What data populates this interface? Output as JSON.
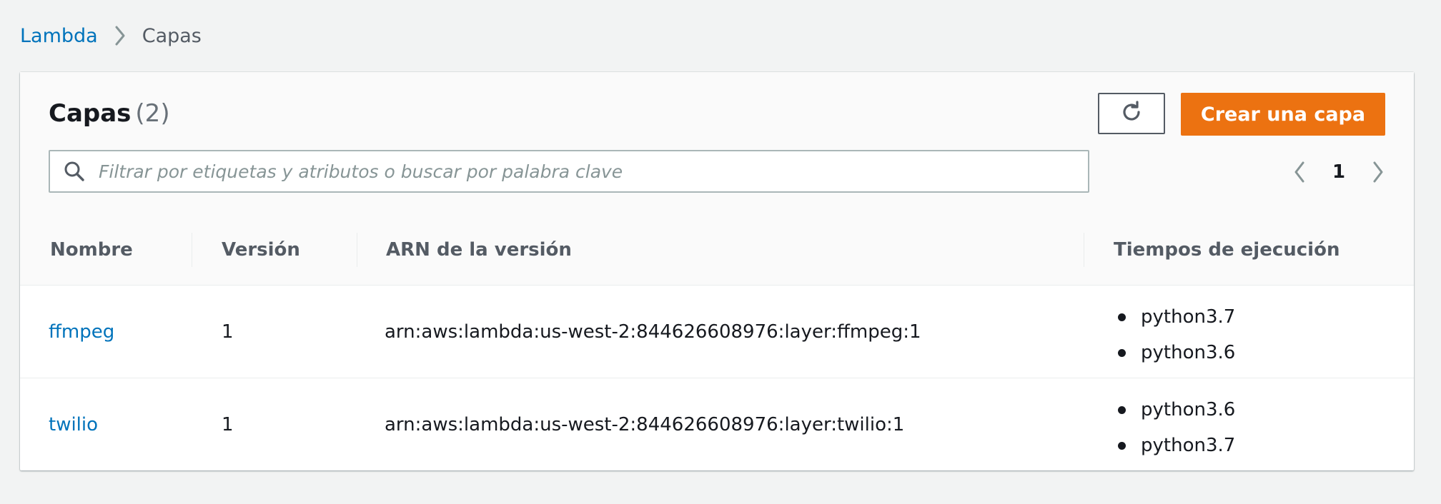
{
  "breadcrumb": {
    "root": "Lambda",
    "current": "Capas"
  },
  "panel": {
    "title": "Capas",
    "count": "(2)",
    "create_label": "Crear una capa",
    "refresh_icon": "refresh-icon"
  },
  "search": {
    "placeholder": "Filtrar por etiquetas y atributos o buscar por palabra clave",
    "value": ""
  },
  "pagination": {
    "current_page": "1"
  },
  "table": {
    "columns": [
      "Nombre",
      "Versión",
      "ARN de la versión",
      "Tiempos de ejecución"
    ],
    "rows": [
      {
        "name": "ffmpeg",
        "version": "1",
        "arn": "arn:aws:lambda:us-west-2:844626608976:layer:ffmpeg:1",
        "runtimes": [
          "python3.7",
          "python3.6"
        ]
      },
      {
        "name": "twilio",
        "version": "1",
        "arn": "arn:aws:lambda:us-west-2:844626608976:layer:twilio:1",
        "runtimes": [
          "python3.6",
          "python3.7"
        ]
      }
    ]
  },
  "colors": {
    "accent": "#ec7211",
    "link": "#0073bb",
    "background": "#f2f3f3"
  }
}
